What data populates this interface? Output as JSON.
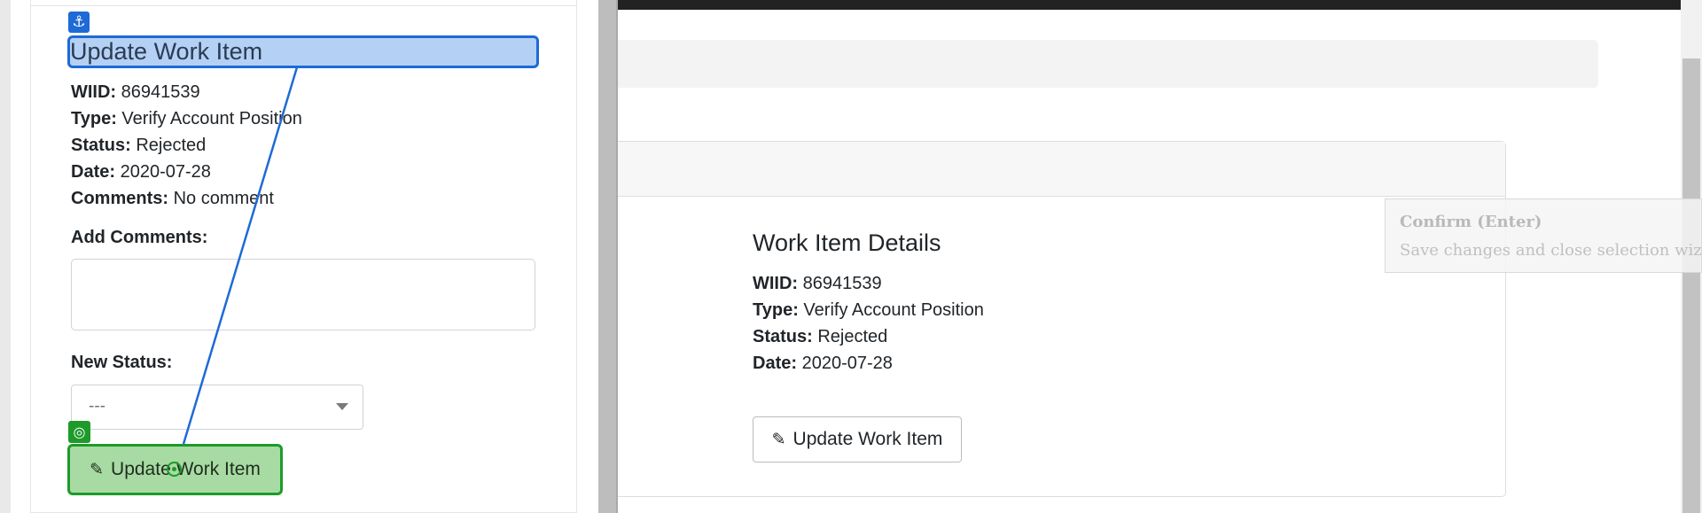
{
  "panel": {
    "title": "Update Work Item",
    "fields": [
      {
        "label": "WIID:",
        "value": "86941539"
      },
      {
        "label": "Type:",
        "value": "Verify Account Position"
      },
      {
        "label": "Status:",
        "value": "Rejected"
      },
      {
        "label": "Date:",
        "value": "2020-07-28"
      },
      {
        "label": "Comments:",
        "value": "No comment"
      }
    ],
    "add_comments_label": "Add Comments:",
    "add_comments_value": "",
    "new_status_label": "New Status:",
    "new_status_value": "---",
    "update_button_label": "Update Work Item",
    "anchor_icon": "anchor-icon",
    "target_icon": "target-icon"
  },
  "details": {
    "title": "Work Item Details",
    "fields": [
      {
        "label": "WIID:",
        "value": "86941539"
      },
      {
        "label": "Type:",
        "value": "Verify Account Position"
      },
      {
        "label": "Status:",
        "value": "Rejected"
      },
      {
        "label": "Date:",
        "value": "2020-07-28"
      }
    ],
    "update_button_label": "Update Work Item",
    "button_icon": "pencil-icon"
  },
  "tooltip": {
    "title": "Confirm (Enter)",
    "description": "Save changes and close selection wizard."
  },
  "colors": {
    "selection_blue": "#1e6ad6",
    "selection_fill": "#b4d0f4",
    "target_green": "#1d9b2a",
    "target_fill": "#a8dba3"
  }
}
